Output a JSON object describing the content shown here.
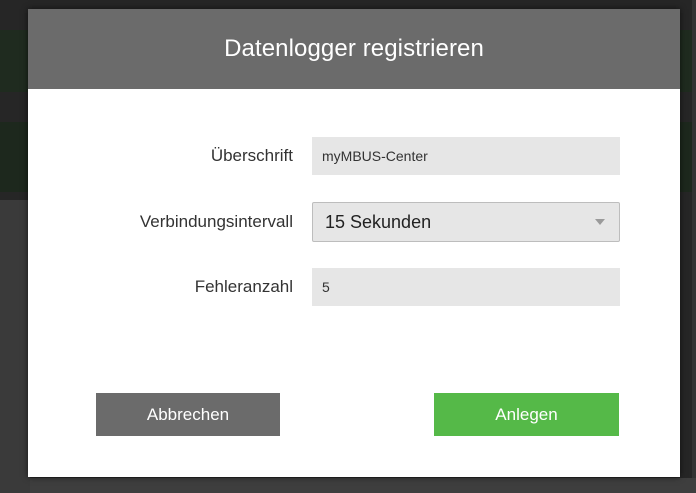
{
  "dialog": {
    "title": "Datenlogger registrieren"
  },
  "form": {
    "heading": {
      "label": "Überschrift",
      "value": "myMBUS-Center"
    },
    "interval": {
      "label": "Verbindungsintervall",
      "selected": "15 Sekunden"
    },
    "error_count": {
      "label": "Fehleranzahl",
      "value": "5"
    }
  },
  "buttons": {
    "cancel_label": "Abbrechen",
    "create_label": "Anlegen"
  },
  "colors": {
    "header_bg": "#6b6b6b",
    "cancel_bg": "#6b6b6b",
    "create_bg": "#55b948",
    "field_bg": "#e6e6e6"
  },
  "icons": {
    "select_arrow": "chevron-down-icon"
  }
}
